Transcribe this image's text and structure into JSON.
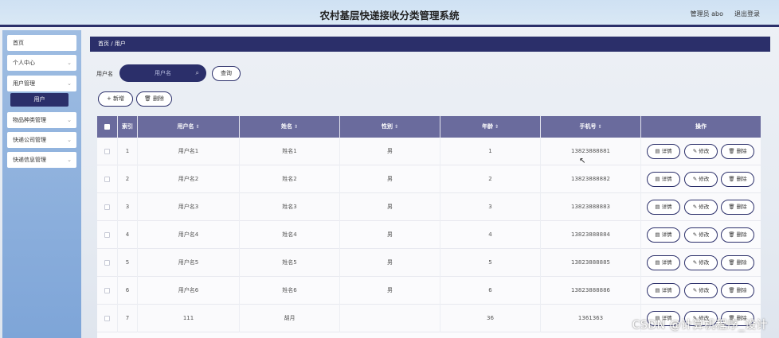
{
  "header": {
    "title": "农村基层快递接收分类管理系统",
    "user": "管理员 abo",
    "logout": "退出登录"
  },
  "sidebar": {
    "items": [
      {
        "label": "首页",
        "chevron": ""
      },
      {
        "label": "个人中心",
        "chevron": "⌄"
      },
      {
        "label": "用户管理",
        "chevron": "⌄"
      },
      {
        "label": "用户",
        "chevron": ""
      },
      {
        "label": "物品种类管理",
        "chevron": "⌄"
      },
      {
        "label": "快递公司管理",
        "chevron": "⌄"
      },
      {
        "label": "快递信息管理",
        "chevron": "⌄"
      }
    ]
  },
  "breadcrumb": "首页 / 用户",
  "search": {
    "label": "用户名",
    "placeholder": "用户名",
    "query_button": "查询"
  },
  "toolbar": {
    "add": "+ 新增",
    "delete": "🗑 删除"
  },
  "table": {
    "headers": [
      "",
      "索引",
      "用户名",
      "姓名",
      "性别",
      "年龄",
      "手机号",
      "操作"
    ],
    "sort_mark": "⇕",
    "rows": [
      {
        "index": "1",
        "username": "用户名1",
        "name": "姓名1",
        "gender": "男",
        "age": "1",
        "phone": "13823888881"
      },
      {
        "index": "2",
        "username": "用户名2",
        "name": "姓名2",
        "gender": "男",
        "age": "2",
        "phone": "13823888882"
      },
      {
        "index": "3",
        "username": "用户名3",
        "name": "姓名3",
        "gender": "男",
        "age": "3",
        "phone": "13823888883"
      },
      {
        "index": "4",
        "username": "用户名4",
        "name": "姓名4",
        "gender": "男",
        "age": "4",
        "phone": "13823888884"
      },
      {
        "index": "5",
        "username": "用户名5",
        "name": "姓名5",
        "gender": "男",
        "age": "5",
        "phone": "13823888885"
      },
      {
        "index": "6",
        "username": "用户名6",
        "name": "姓名6",
        "gender": "男",
        "age": "6",
        "phone": "13823888886"
      },
      {
        "index": "7",
        "username": "111",
        "name": "胡月",
        "gender": "",
        "age": "36",
        "phone": "1361363"
      }
    ],
    "actions": {
      "detail": "详情",
      "edit": "修改",
      "delete": "删除"
    }
  },
  "watermark": "CSDN @计算机程序_设计",
  "colors": {
    "primary": "#2b2f6a",
    "table_head": "#6a6b9d",
    "sidebar": "#8fb2de"
  }
}
